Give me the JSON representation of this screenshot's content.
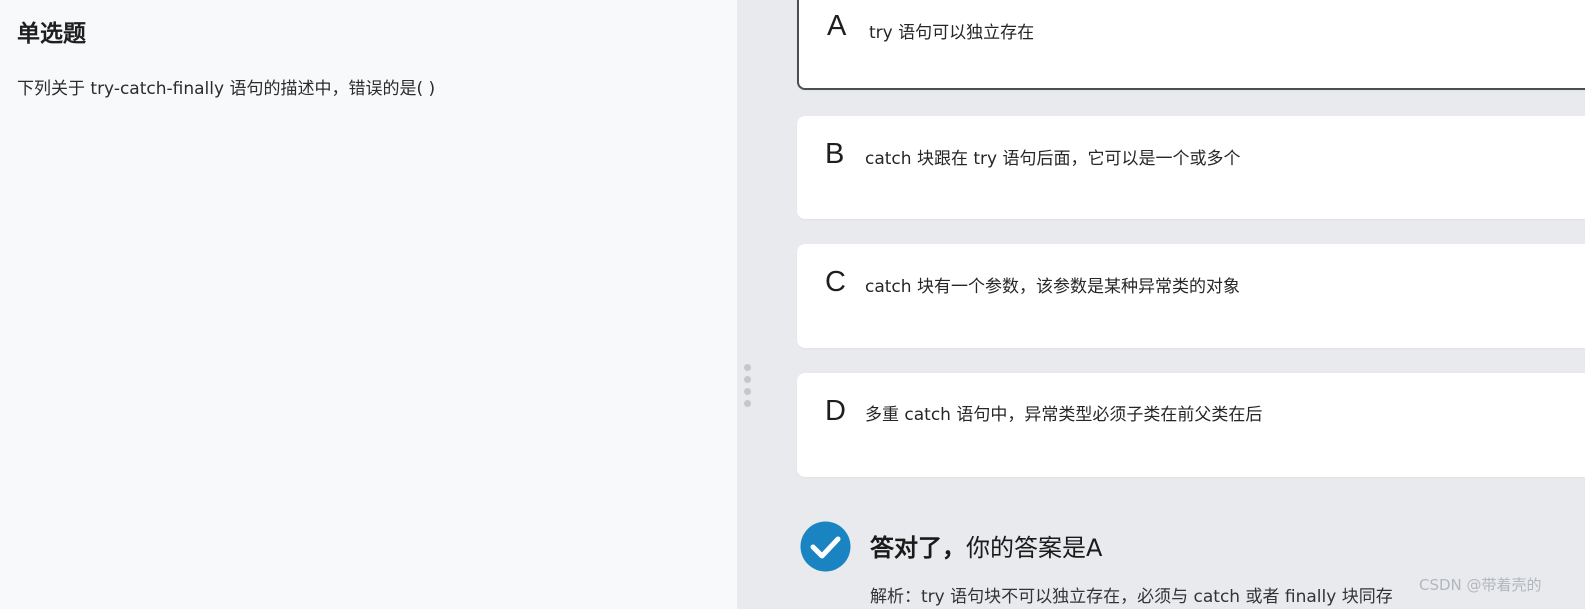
{
  "question": {
    "type": "单选题",
    "text": "下列关于 try-catch-finally 语句的描述中，错误的是( )"
  },
  "options": [
    {
      "letter": "A",
      "text": "try 语句可以独立存在"
    },
    {
      "letter": "B",
      "text": "catch 块跟在 try 语句后面，它可以是一个或多个"
    },
    {
      "letter": "C",
      "text": "catch 块有一个参数，该参数是某种异常类的对象"
    },
    {
      "letter": "D",
      "text": "多重 catch 语句中，异常类型必须子类在前父类在后"
    }
  ],
  "result": {
    "status": "答对了，",
    "answer": "你的答案是A",
    "analysis": "解析：try 语句块不可以独立存在，必须与 catch 或者 finally 块同存"
  },
  "watermark": "CSDN @带着壳的",
  "colors": {
    "check_circle": "#1a84c2",
    "left_bg": "#f8f9fb",
    "right_bg": "#e8eaed"
  }
}
